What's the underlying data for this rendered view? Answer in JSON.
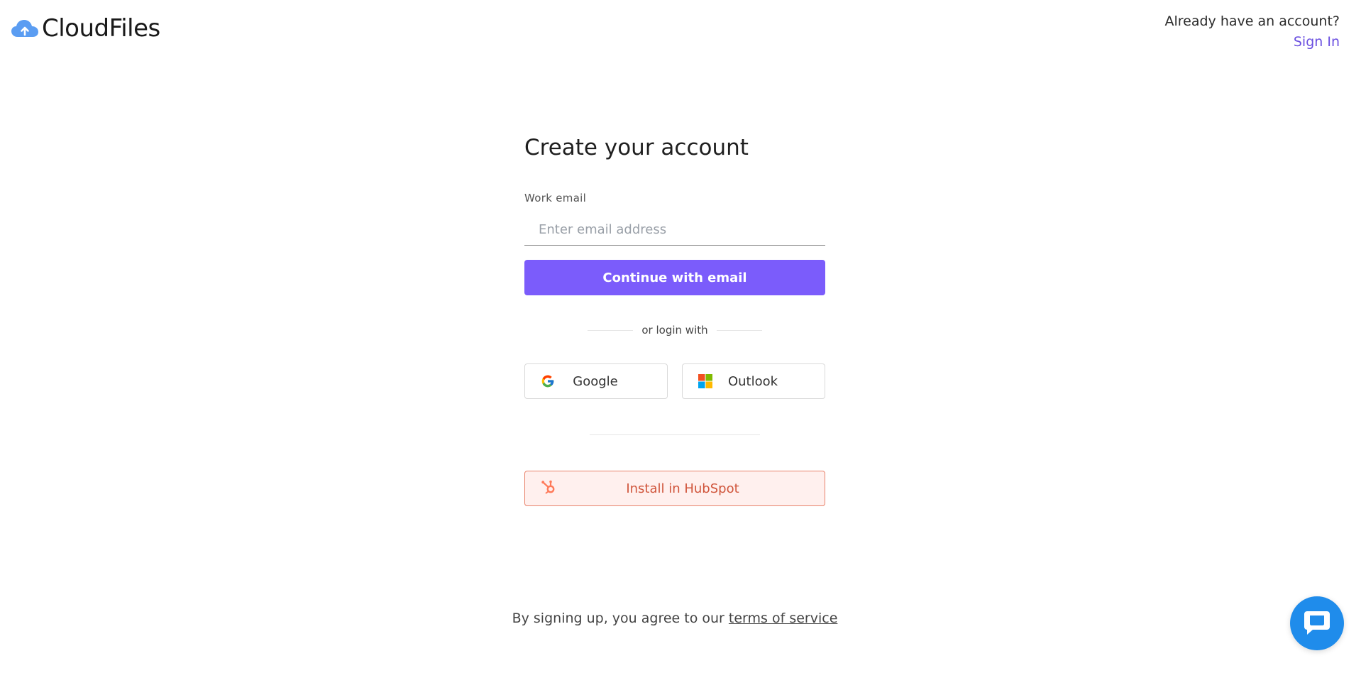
{
  "brand": {
    "name": "CloudFiles",
    "icon": "cloud-upload-icon",
    "color": "#4a90f0"
  },
  "header": {
    "prompt": "Already have an account?",
    "signin_label": "Sign In"
  },
  "form": {
    "title": "Create your account",
    "email_label": "Work email",
    "email_placeholder": "Enter email address",
    "email_value": "",
    "continue_label": "Continue with email",
    "divider_text": "or login with",
    "google_label": "Google",
    "outlook_label": "Outlook",
    "hubspot_label": "Install in HubSpot"
  },
  "footer": {
    "terms_prefix": "By signing up, you agree to our",
    "terms_link": "terms of service"
  },
  "chat": {
    "icon": "chat-bubble-icon"
  },
  "colors": {
    "primary": "#7b5cfb",
    "link": "#6a4fe0",
    "hubspot": "#d0553b",
    "hubspot_bg": "#fff0ee",
    "chat": "#1f8ceb"
  }
}
